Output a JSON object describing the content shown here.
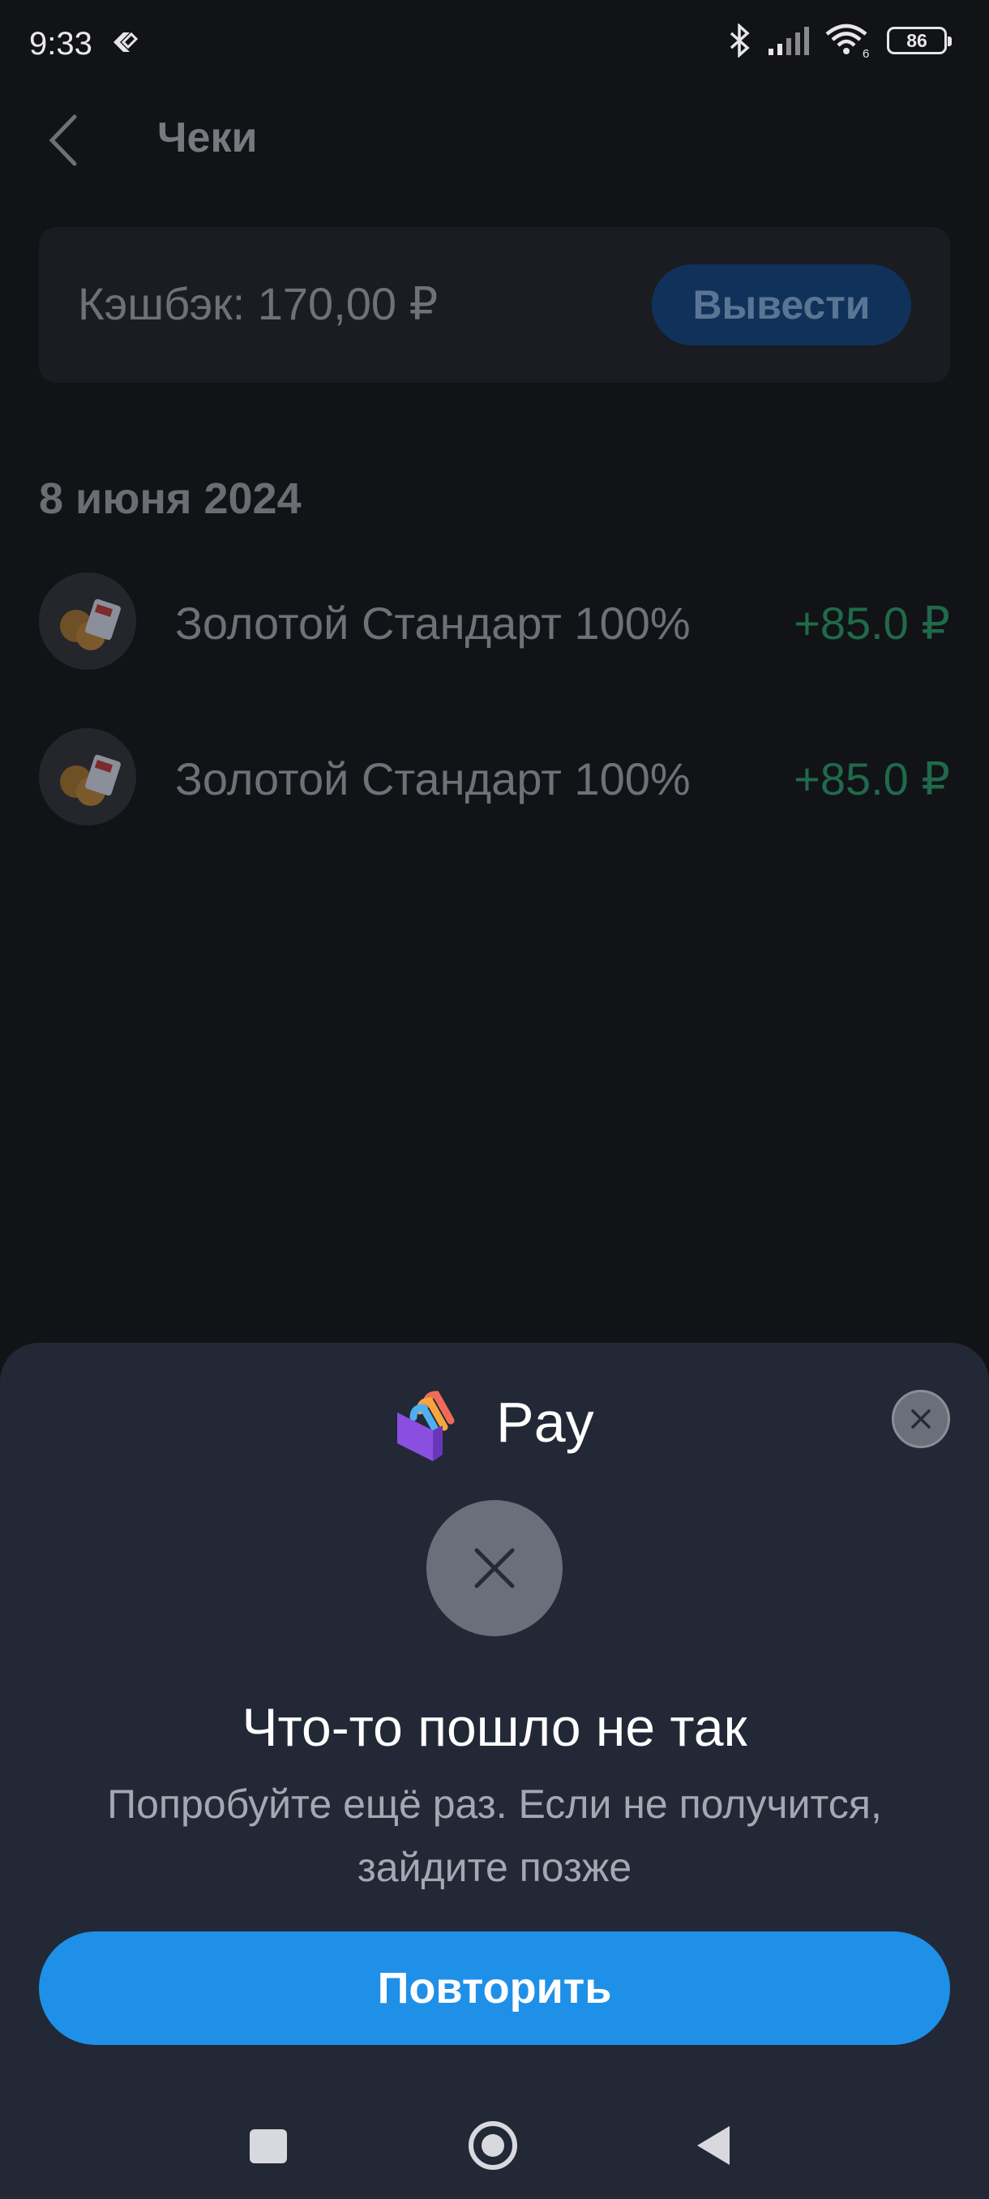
{
  "status_bar": {
    "time": "9:33",
    "battery": "86",
    "icons": [
      "app-notification-icon",
      "bluetooth-icon",
      "signal-icon",
      "wifi-icon",
      "battery-icon"
    ]
  },
  "header": {
    "title": "Чеки",
    "back_icon": "chevron-left-icon"
  },
  "cashback": {
    "text": "Кэшбэк: 170,00 ₽",
    "withdraw_label": "Вывести"
  },
  "receipts": {
    "date": "8 июня 2024",
    "items": [
      {
        "name": "Золотой Стандарт 100%",
        "amount": "+85.0 ₽"
      },
      {
        "name": "Золотой Стандарт 100%",
        "amount": "+85.0 ₽"
      }
    ]
  },
  "sheet": {
    "brand": "Pay",
    "title": "Что-то пошло не так",
    "message": "Попробуйте ещё раз. Если не получится, зайдите позже",
    "retry_label": "Повторить"
  },
  "colors": {
    "background": "#121317",
    "sheet": "#232836",
    "accent": "#1e90e8",
    "amount": "#1f6a4a"
  }
}
